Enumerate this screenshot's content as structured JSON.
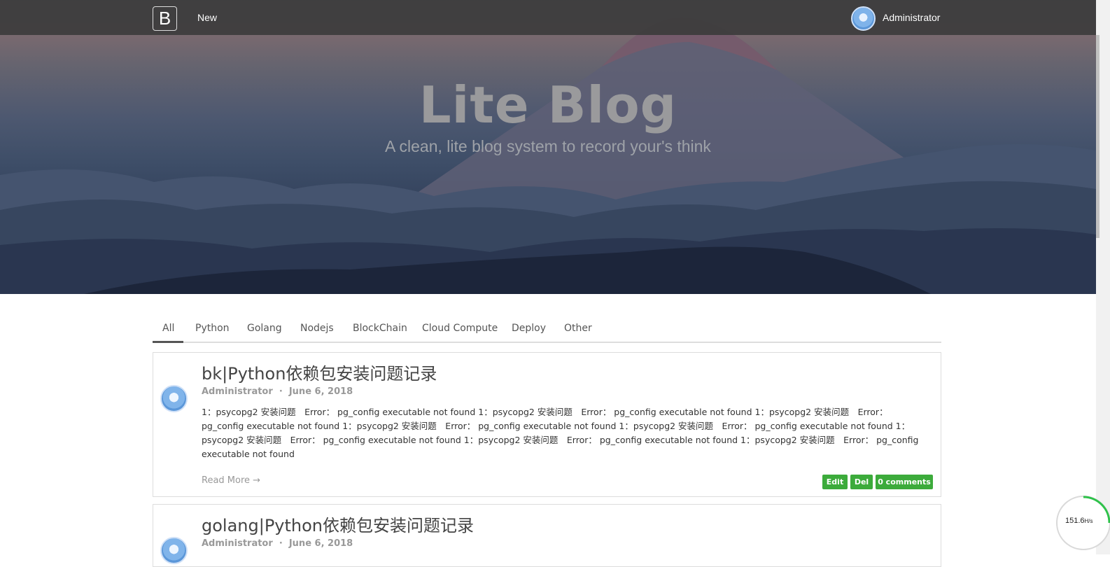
{
  "navbar": {
    "brand": "B",
    "new_label": "New",
    "user_name": "Administrator",
    "user_avatar_icon": "avatar-icon"
  },
  "hero": {
    "title": "Lite Blog",
    "subtitle": "A clean, lite blog system to record your's think"
  },
  "tabs": [
    {
      "label": "All",
      "active": true
    },
    {
      "label": "Python"
    },
    {
      "label": "Golang"
    },
    {
      "label": "Nodejs"
    },
    {
      "label": "BlockChain"
    },
    {
      "label": "Cloud Compute"
    },
    {
      "label": "Deploy"
    },
    {
      "label": "Other"
    }
  ],
  "posts": [
    {
      "title": "bk|Python依赖包安装问题记录",
      "author": "Administrator",
      "date": "June 6, 2018",
      "excerpt": "1：psycopg2 安装问题　Error： pg_config executable not found 1：psycopg2 安装问题　Error： pg_config executable not found 1：psycopg2 安装问题　Error： pg_config executable not found 1：psycopg2 安装问题　Error： pg_config executable not found 1：psycopg2 安装问题　Error： pg_config executable not found 1：psycopg2 安装问题　Error： pg_config executable not found 1：psycopg2 安装问题　Error： pg_config executable not found 1：psycopg2 安装问题　Error： pg_config executable not found",
      "read_more": "Read More →",
      "edit_label": "Edit",
      "del_label": "Del",
      "comments_label": "0 comments"
    },
    {
      "title": "golang|Python依赖包安装问题记录",
      "author": "Administrator",
      "date": "June 6, 2018"
    }
  ],
  "speed_widget": {
    "value": "151.6",
    "unit": "H/s"
  },
  "colors": {
    "navbar": "#3c3c3c",
    "button_green": "#3cab3b"
  }
}
